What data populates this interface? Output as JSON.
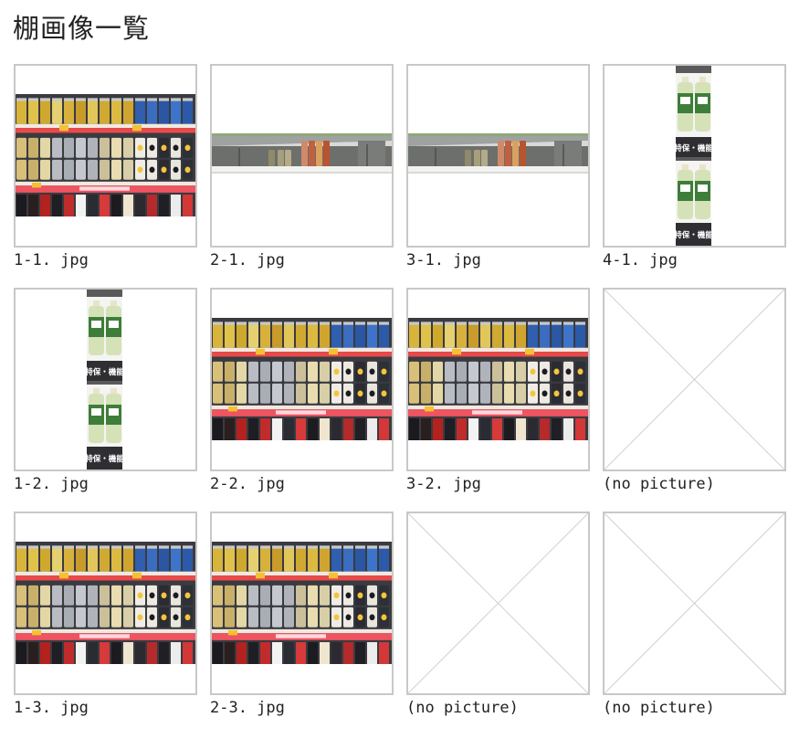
{
  "page": {
    "title": "棚画像一覧"
  },
  "colors": {
    "border": "#c8c8c8",
    "placeholder_line": "#d0d0d0"
  },
  "tiles": [
    {
      "caption": "1-1. jpg",
      "kind": "shelf-full"
    },
    {
      "caption": "2-1. jpg",
      "kind": "shelf-strip"
    },
    {
      "caption": "3-1. jpg",
      "kind": "shelf-strip"
    },
    {
      "caption": "4-1. jpg",
      "kind": "bottles-tall"
    },
    {
      "caption": "1-2. jpg",
      "kind": "bottles-tall"
    },
    {
      "caption": "2-2. jpg",
      "kind": "shelf-full"
    },
    {
      "caption": "3-2. jpg",
      "kind": "shelf-full"
    },
    {
      "caption": "(no picture)",
      "kind": "placeholder"
    },
    {
      "caption": "1-3. jpg",
      "kind": "shelf-full"
    },
    {
      "caption": "2-3. jpg",
      "kind": "shelf-full"
    },
    {
      "caption": "(no picture)",
      "kind": "placeholder"
    },
    {
      "caption": "(no picture)",
      "kind": "placeholder"
    }
  ],
  "bottle_label": "特保・機能"
}
